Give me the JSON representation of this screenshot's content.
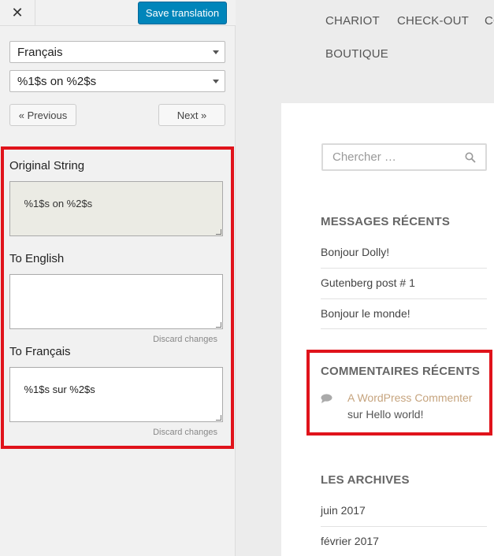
{
  "editor": {
    "close_label": "✕",
    "save_label": "Save translation",
    "language_select": "Français",
    "string_select": "%1$s on %2$s",
    "previous_label": "« Previous",
    "next_label": "Next »",
    "original_label": "Original String",
    "original_value": "%1$s on %2$s",
    "english_label": "To English",
    "english_value": "",
    "french_label": "To Français",
    "french_value": "%1$s sur %2$s",
    "discard_label": "Discard changes"
  },
  "preview": {
    "menu": [
      "CHARIOT",
      "CHECK-OUT",
      "CO",
      "BOUTIQUE"
    ],
    "search_placeholder": "Chercher …",
    "recent_posts_title": "MESSAGES RÉCENTS",
    "recent_posts": [
      "Bonjour Dolly!",
      "Gutenberg post # 1",
      "Bonjour le monde!"
    ],
    "recent_comments_title": "COMMENTAIRES RÉCENTS",
    "comment_author": "A WordPress Commenter",
    "comment_on": "sur Hello world!",
    "archives_title": "LES ARCHIVES",
    "archives": [
      "juin 2017",
      "février 2017"
    ]
  },
  "colors": {
    "primary_button": "#0085ba",
    "highlight": "#e0131b",
    "comment_author": "#c6a47e"
  }
}
